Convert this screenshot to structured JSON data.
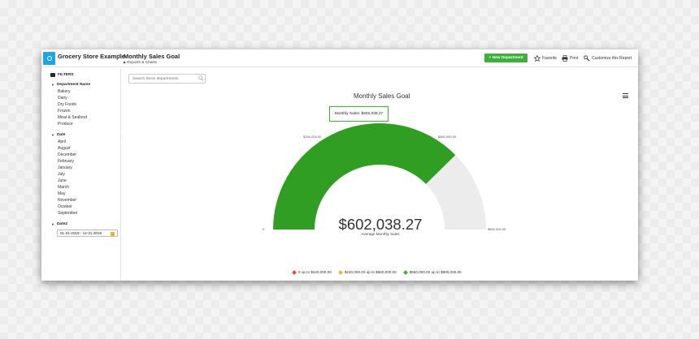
{
  "app": {
    "title": "Grocery Store Example"
  },
  "report": {
    "title": "Monthly Sales Goal",
    "breadcrumb": "Reports & Charts"
  },
  "toolbar": {
    "new_department_label": "+ New Department",
    "favorite_label": "Favorite",
    "print_label": "Print",
    "customize_label": "Customize this Report"
  },
  "sidebar": {
    "filters_label": "FILTERS",
    "department": {
      "label": "Department Name",
      "options": [
        "Bakery",
        "Dairy",
        "Dry Foods",
        "Frozen",
        "Meat & Seafood",
        "Produce"
      ]
    },
    "date": {
      "label": "Date",
      "options": [
        "April",
        "August",
        "December",
        "February",
        "January",
        "July",
        "June",
        "March",
        "May",
        "November",
        "October",
        "September"
      ]
    },
    "date2": {
      "label": "Date2",
      "value": "01-31-2019 - 12-31-2019"
    }
  },
  "search": {
    "placeholder": "Search these departments"
  },
  "colors": {
    "accent": "#3fae3a",
    "gauge_fill": "#2f9e22",
    "gauge_track": "#ececec",
    "logo": "#1ea5e8"
  },
  "chart_data": {
    "type": "gauge",
    "title": "Monthly Sales Goal",
    "value": 602038.27,
    "value_label": "$602,038.27",
    "subtitle": "Average Monthly Sales",
    "min": 0,
    "max": 800000,
    "tooltip": "Monthly Sales: $602,038.27",
    "ticks": [
      {
        "value": 0,
        "label": "0"
      },
      {
        "value": 240000,
        "label": "$240,000.00"
      },
      {
        "value": 560000,
        "label": "$560,000.00"
      },
      {
        "value": 800000,
        "label": "$800,000.00"
      }
    ],
    "bands": [
      {
        "label": "0 up to $240,000.00",
        "color": "#e8453c"
      },
      {
        "label": "$240,000.00 up to $560,000.00",
        "color": "#e8b23c"
      },
      {
        "label": "$560,000.00 up to $800,000.00",
        "color": "#3fae3a"
      }
    ]
  }
}
